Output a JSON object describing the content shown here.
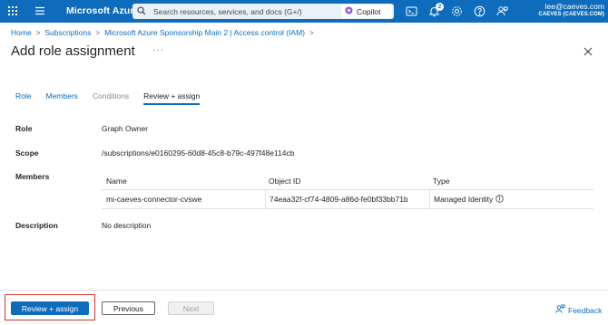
{
  "topbar": {
    "brand": "Microsoft Azure",
    "search_placeholder": "Search resources, services, and docs (G+/)",
    "copilot_label": "Copilot",
    "notification_count": "2",
    "account_email": "lee@caeves.com",
    "account_tenant": "CAEVES (CAEVES.COM)",
    "accent_color": "#0f6cbd"
  },
  "breadcrumb": {
    "items": [
      "Home",
      "Subscriptions",
      "Microsoft Azure Sponsorship Main 2 | Access control (IAM)"
    ],
    "separator": ">"
  },
  "page": {
    "title": "Add role assignment",
    "more_label": "···"
  },
  "tabs": [
    {
      "label": "Role",
      "state": "link"
    },
    {
      "label": "Members",
      "state": "link"
    },
    {
      "label": "Conditions",
      "state": "disabled"
    },
    {
      "label": "Review + assign",
      "state": "active"
    }
  ],
  "details": {
    "role_label": "Role",
    "role_value": "Graph Owner",
    "scope_label": "Scope",
    "scope_value": "/subscriptions/e0160295-60d8-45c8-b79c-497f48e114cb",
    "members_label": "Members",
    "description_label": "Description",
    "description_value": "No description"
  },
  "members_table": {
    "columns": [
      "Name",
      "Object ID",
      "Type"
    ],
    "rows": [
      {
        "name": "mi-caeves-connector-cvswe",
        "object_id": "74eaa32f-cf74-4809-a86d-fe0bf33bb71b",
        "type": "Managed Identity"
      }
    ]
  },
  "footer": {
    "primary_button": "Review + assign",
    "previous_button": "Previous",
    "next_button": "Next",
    "feedback_label": "Feedback"
  },
  "icons": [
    "waffle-icon",
    "hamburger-icon",
    "search-icon",
    "copilot-icon",
    "cloud-shell-icon",
    "notifications-icon",
    "settings-icon",
    "help-icon",
    "feedback-person-icon",
    "close-icon",
    "info-icon",
    "feedback-icon"
  ]
}
